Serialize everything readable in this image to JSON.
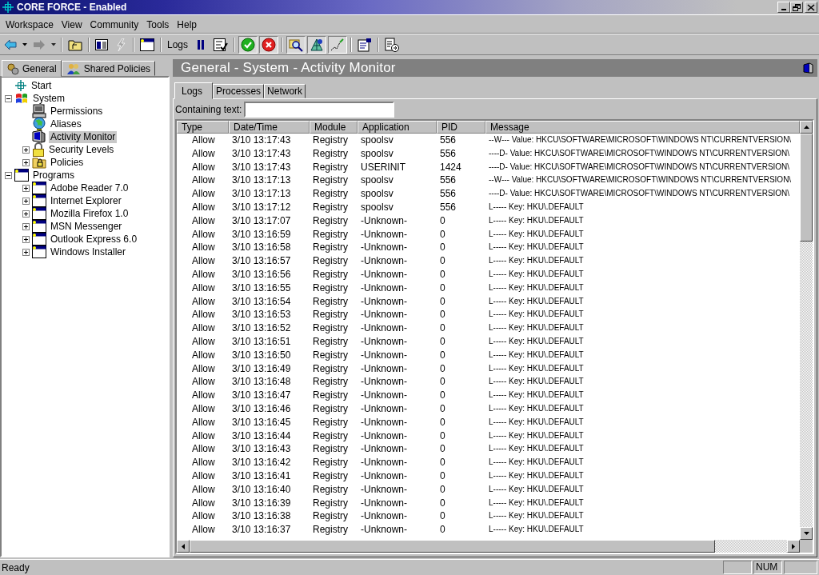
{
  "window": {
    "title": "CORE FORCE - Enabled"
  },
  "menu": [
    "Workspace",
    "View",
    "Community",
    "Tools",
    "Help"
  ],
  "toolbar": [
    {
      "kind": "back",
      "disabled": false
    },
    {
      "kind": "caret",
      "disabled": false
    },
    {
      "kind": "forward",
      "disabled": true
    },
    {
      "kind": "caret",
      "disabled": true
    },
    {
      "kind": "sep"
    },
    {
      "kind": "folder-up",
      "disabled": false
    },
    {
      "kind": "sep"
    },
    {
      "kind": "panes",
      "disabled": false
    },
    {
      "kind": "bolt",
      "disabled": true
    },
    {
      "kind": "sep"
    },
    {
      "kind": "window",
      "disabled": false
    },
    {
      "kind": "sep"
    },
    {
      "kind": "label",
      "text": "Logs"
    },
    {
      "kind": "pause",
      "disabled": false
    },
    {
      "kind": "checklist",
      "disabled": false
    },
    {
      "kind": "sep"
    },
    {
      "kind": "ok",
      "disabled": false,
      "pressed": true
    },
    {
      "kind": "cancel",
      "disabled": false,
      "pressed": true
    },
    {
      "kind": "sep"
    },
    {
      "kind": "magnify",
      "disabled": false,
      "pressed": true
    },
    {
      "kind": "network",
      "disabled": false,
      "pressed": true
    },
    {
      "kind": "graph",
      "disabled": false,
      "pressed": true
    },
    {
      "kind": "sep"
    },
    {
      "kind": "properties",
      "disabled": false
    },
    {
      "kind": "sep"
    },
    {
      "kind": "export",
      "disabled": false
    }
  ],
  "sidebar": {
    "tabs": [
      {
        "label": "General",
        "kind": "gears",
        "selected": true
      },
      {
        "label": "Shared Policies",
        "kind": "people",
        "selected": false
      }
    ],
    "tree": [
      {
        "label": "Start",
        "kind": "crosshair",
        "selected": false
      },
      {
        "label": "System",
        "kind": "system",
        "expanded": true,
        "selected": false,
        "children": [
          {
            "label": "Permissions",
            "kind": "computer",
            "selected": false
          },
          {
            "label": "Aliases",
            "kind": "globe",
            "selected": false
          },
          {
            "label": "Activity Monitor",
            "kind": "monitor",
            "selected": true
          },
          {
            "label": "Security Levels",
            "kind": "lock",
            "expanded": false,
            "selected": false
          },
          {
            "label": "Policies",
            "kind": "folder-lock",
            "expanded": false,
            "selected": false
          }
        ]
      },
      {
        "label": "Programs",
        "kind": "window",
        "expanded": true,
        "selected": false,
        "children": [
          {
            "label": "Adobe Reader 7.0",
            "kind": "window",
            "expanded": false,
            "selected": false
          },
          {
            "label": "Internet Explorer",
            "kind": "window",
            "expanded": false,
            "selected": false
          },
          {
            "label": "Mozilla Firefox 1.0",
            "kind": "window",
            "expanded": false,
            "selected": false
          },
          {
            "label": "MSN Messenger",
            "kind": "window",
            "expanded": false,
            "selected": false
          },
          {
            "label": "Outlook Express 6.0",
            "kind": "window",
            "expanded": false,
            "selected": false
          },
          {
            "label": "Windows Installer",
            "kind": "window",
            "expanded": false,
            "selected": false
          }
        ]
      }
    ]
  },
  "content": {
    "title": "General - System - Activity Monitor",
    "tabs": [
      {
        "label": "Logs",
        "selected": true
      },
      {
        "label": "Processes",
        "selected": false
      },
      {
        "label": "Network",
        "selected": false
      }
    ],
    "filter": {
      "label": "Containing text:"
    },
    "table": {
      "columns": [
        "Type",
        "Date/Time",
        "Module",
        "Application",
        "PID",
        "Message"
      ],
      "rows": [
        [
          "Allow",
          "3/10 13:17:43",
          "Registry",
          "spoolsv",
          "556",
          "--W--- Value: HKCU\\SOFTWARE\\MICROSOFT\\WINDOWS NT\\CURRENTVERSION\\"
        ],
        [
          "Allow",
          "3/10 13:17:43",
          "Registry",
          "spoolsv",
          "556",
          "----D- Value: HKCU\\SOFTWARE\\MICROSOFT\\WINDOWS NT\\CURRENTVERSION\\"
        ],
        [
          "Allow",
          "3/10 13:17:43",
          "Registry",
          "USERINIT",
          "1424",
          "----D- Value: HKCU\\SOFTWARE\\MICROSOFT\\WINDOWS NT\\CURRENTVERSION\\"
        ],
        [
          "Allow",
          "3/10 13:17:13",
          "Registry",
          "spoolsv",
          "556",
          "--W--- Value: HKCU\\SOFTWARE\\MICROSOFT\\WINDOWS NT\\CURRENTVERSION\\"
        ],
        [
          "Allow",
          "3/10 13:17:13",
          "Registry",
          "spoolsv",
          "556",
          "----D- Value: HKCU\\SOFTWARE\\MICROSOFT\\WINDOWS NT\\CURRENTVERSION\\"
        ],
        [
          "Allow",
          "3/10 13:17:12",
          "Registry",
          "spoolsv",
          "556",
          "L----- Key: HKU\\.DEFAULT"
        ],
        [
          "Allow",
          "3/10 13:17:07",
          "Registry",
          "-Unknown-",
          "0",
          "L----- Key: HKU\\.DEFAULT"
        ],
        [
          "Allow",
          "3/10 13:16:59",
          "Registry",
          "-Unknown-",
          "0",
          "L----- Key: HKU\\.DEFAULT"
        ],
        [
          "Allow",
          "3/10 13:16:58",
          "Registry",
          "-Unknown-",
          "0",
          "L----- Key: HKU\\.DEFAULT"
        ],
        [
          "Allow",
          "3/10 13:16:57",
          "Registry",
          "-Unknown-",
          "0",
          "L----- Key: HKU\\.DEFAULT"
        ],
        [
          "Allow",
          "3/10 13:16:56",
          "Registry",
          "-Unknown-",
          "0",
          "L----- Key: HKU\\.DEFAULT"
        ],
        [
          "Allow",
          "3/10 13:16:55",
          "Registry",
          "-Unknown-",
          "0",
          "L----- Key: HKU\\.DEFAULT"
        ],
        [
          "Allow",
          "3/10 13:16:54",
          "Registry",
          "-Unknown-",
          "0",
          "L----- Key: HKU\\.DEFAULT"
        ],
        [
          "Allow",
          "3/10 13:16:53",
          "Registry",
          "-Unknown-",
          "0",
          "L----- Key: HKU\\.DEFAULT"
        ],
        [
          "Allow",
          "3/10 13:16:52",
          "Registry",
          "-Unknown-",
          "0",
          "L----- Key: HKU\\.DEFAULT"
        ],
        [
          "Allow",
          "3/10 13:16:51",
          "Registry",
          "-Unknown-",
          "0",
          "L----- Key: HKU\\.DEFAULT"
        ],
        [
          "Allow",
          "3/10 13:16:50",
          "Registry",
          "-Unknown-",
          "0",
          "L----- Key: HKU\\.DEFAULT"
        ],
        [
          "Allow",
          "3/10 13:16:49",
          "Registry",
          "-Unknown-",
          "0",
          "L----- Key: HKU\\.DEFAULT"
        ],
        [
          "Allow",
          "3/10 13:16:48",
          "Registry",
          "-Unknown-",
          "0",
          "L----- Key: HKU\\.DEFAULT"
        ],
        [
          "Allow",
          "3/10 13:16:47",
          "Registry",
          "-Unknown-",
          "0",
          "L----- Key: HKU\\.DEFAULT"
        ],
        [
          "Allow",
          "3/10 13:16:46",
          "Registry",
          "-Unknown-",
          "0",
          "L----- Key: HKU\\.DEFAULT"
        ],
        [
          "Allow",
          "3/10 13:16:45",
          "Registry",
          "-Unknown-",
          "0",
          "L----- Key: HKU\\.DEFAULT"
        ],
        [
          "Allow",
          "3/10 13:16:44",
          "Registry",
          "-Unknown-",
          "0",
          "L----- Key: HKU\\.DEFAULT"
        ],
        [
          "Allow",
          "3/10 13:16:43",
          "Registry",
          "-Unknown-",
          "0",
          "L----- Key: HKU\\.DEFAULT"
        ],
        [
          "Allow",
          "3/10 13:16:42",
          "Registry",
          "-Unknown-",
          "0",
          "L----- Key: HKU\\.DEFAULT"
        ],
        [
          "Allow",
          "3/10 13:16:41",
          "Registry",
          "-Unknown-",
          "0",
          "L----- Key: HKU\\.DEFAULT"
        ],
        [
          "Allow",
          "3/10 13:16:40",
          "Registry",
          "-Unknown-",
          "0",
          "L----- Key: HKU\\.DEFAULT"
        ],
        [
          "Allow",
          "3/10 13:16:39",
          "Registry",
          "-Unknown-",
          "0",
          "L----- Key: HKU\\.DEFAULT"
        ],
        [
          "Allow",
          "3/10 13:16:38",
          "Registry",
          "-Unknown-",
          "0",
          "L----- Key: HKU\\.DEFAULT"
        ],
        [
          "Allow",
          "3/10 13:16:37",
          "Registry",
          "-Unknown-",
          "0",
          "L----- Key: HKU\\.DEFAULT"
        ]
      ]
    }
  },
  "status_bar": {
    "text": "Ready",
    "indicator": "NUM"
  }
}
